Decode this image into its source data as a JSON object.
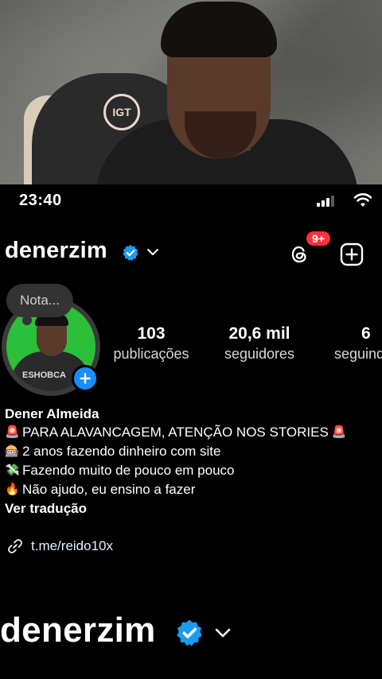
{
  "status_bar": {
    "time": "23:40"
  },
  "header": {
    "username": "denerzim",
    "threads_badge": "9+"
  },
  "profile": {
    "note_label": "Nota...",
    "avatar_shirt_text": "ESHOBCA",
    "stats": [
      {
        "value": "103",
        "label": "publicações"
      },
      {
        "value": "20,6 mil",
        "label": "seguidores"
      },
      {
        "value": "6",
        "label": "seguindo"
      }
    ],
    "display_name": "Dener Almeida",
    "bio_lines": [
      {
        "emoji": "🚨",
        "text": "PARA ALAVANCAGEM, ATENÇÃO NOS STORIES",
        "trailing_emoji": "🚨"
      },
      {
        "emoji": "🎰",
        "text": "2 anos fazendo dinheiro com site"
      },
      {
        "emoji": "💸",
        "text": "Fazendo muito de pouco em pouco"
      },
      {
        "emoji": "🔥",
        "text": "Não ajudo, eu ensino a fazer"
      }
    ],
    "translate_label": "Ver tradução",
    "link_text": "t.me/reido10x"
  },
  "overlay": {
    "username": "denerzim"
  },
  "cam": {
    "chair_logo": "IGT"
  },
  "colors": {
    "accent_blue": "#1a8cff",
    "badge_red": "#ff3040",
    "verified_blue": "#1d9bf0"
  },
  "icons": [
    "verified-icon",
    "chevron-down-icon",
    "threads-icon",
    "create-icon",
    "add-story-icon",
    "link-icon",
    "wifi-icon",
    "signal-icon"
  ]
}
